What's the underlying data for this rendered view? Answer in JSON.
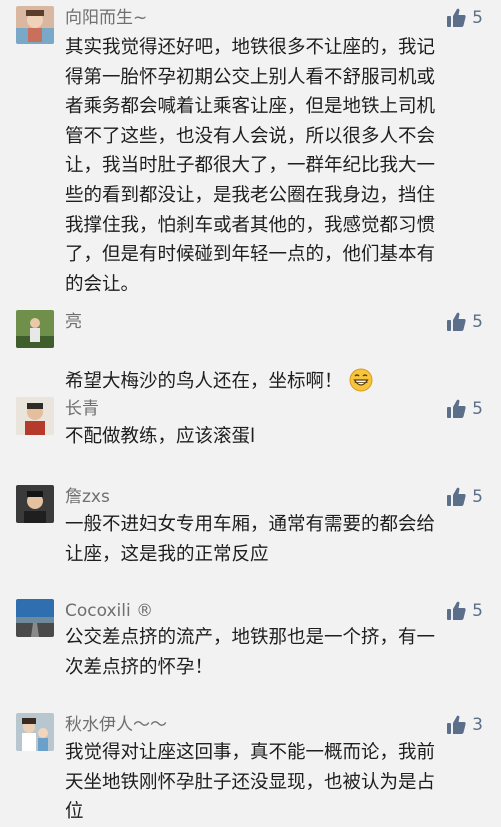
{
  "comments": [
    {
      "author": "向阳而生~",
      "likes": "5",
      "text": "其实我觉得还好吧，地铁很多不让座的，我记\n得第一胎怀孕初期公交上别人看不舒服司机或\n者乘务都会喊着让乘客让座，但是地铁上司机\n管不了这些，也没有人会说，所以很多人不会\n让，我当时肚子都很大了，一群年纪比我大一\n些的看到都没让，是我老公圈在我身边，挡住\n我撑住我，怕刹车或者其他的，我感觉都习惯\n了，但是有时候碰到年轻一点的，他们基本有\n的会让。"
    },
    {
      "author": "亮",
      "likes": "5",
      "text": "希望大梅沙的鸟人还在，坐标啊！",
      "emoji": "grinning-face-emoji"
    },
    {
      "author": "长青",
      "likes": "5",
      "text": "不配做教练，应该滚蛋l"
    },
    {
      "author": "詹zxs",
      "likes": "5",
      "text": "一般不进妇女专用车厢，通常有需要的都会给\n让座，这是我的正常反应"
    },
    {
      "author": "Cocoxili ®",
      "likes": "5",
      "text": "公交差点挤的流产，地铁那也是一个挤，有一\n次差点挤的怀孕！"
    },
    {
      "author": "秋水伊人～～",
      "likes": "3",
      "text": "我觉得对让座这回事，真不能一概而论，我前\n天坐地铁刚怀孕肚子还没显现，也被认为是占\n位"
    }
  ],
  "icons": {
    "like": "thumbs-up-icon"
  },
  "colors": {
    "like": "#5b6e8a",
    "name": "#6f6f6f",
    "text": "#1e1e1e",
    "background": "#f2f2f2"
  }
}
